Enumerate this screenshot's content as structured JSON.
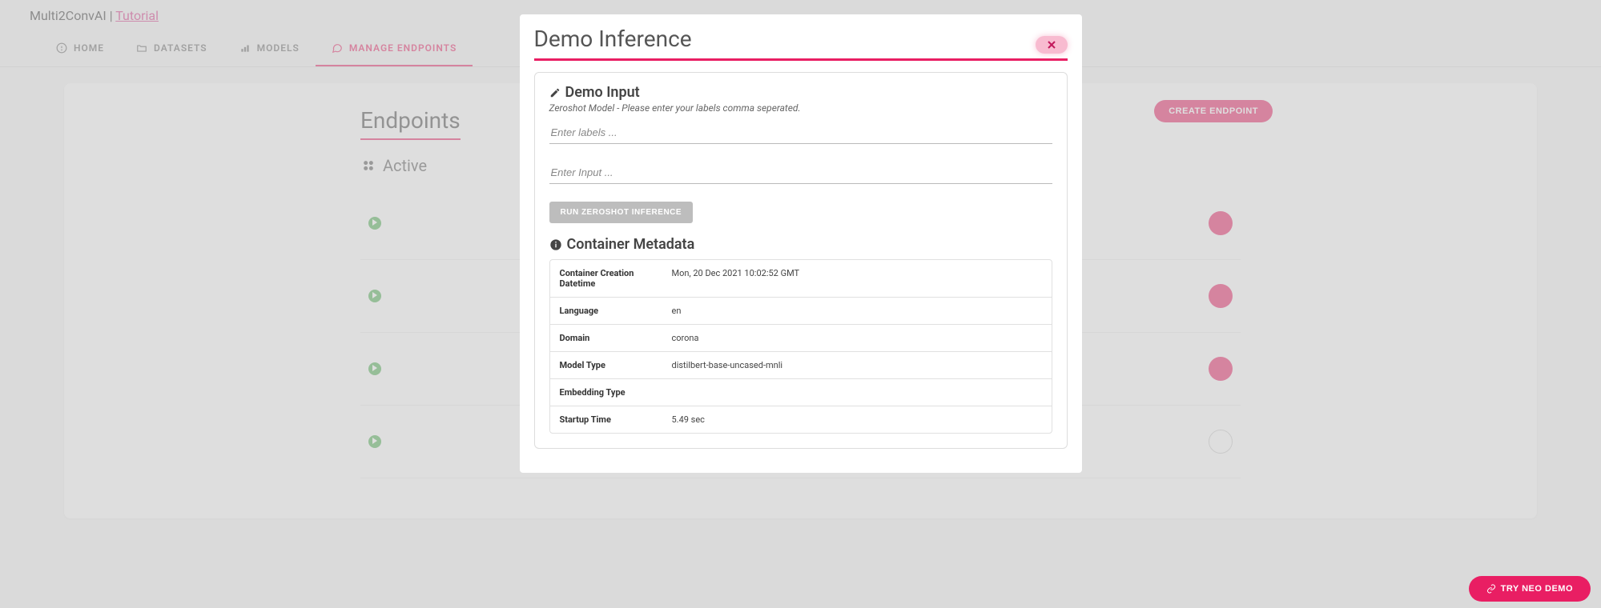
{
  "header": {
    "brand": "Multi2ConvAI",
    "sep": " | ",
    "tutorial": "Tutorial"
  },
  "nav": {
    "home": "HOME",
    "datasets": "DATASETS",
    "models": "MODELS",
    "manage": "MANAGE ENDPOINTS"
  },
  "page": {
    "title": "Endpoints",
    "create_btn": "CREATE ENDPOINT",
    "active_section": "Active"
  },
  "modal": {
    "title": "Demo Inference",
    "demo_input_heading": "Demo Input",
    "hint": "Zeroshot Model - Please enter your labels comma seperated.",
    "labels_placeholder": "Enter labels ...",
    "input_placeholder": "Enter Input ...",
    "run_btn": "RUN ZEROSHOT INFERENCE",
    "metadata_heading": "Container Metadata",
    "rows": [
      {
        "k": "Container Creation Datetime",
        "v": "Mon, 20 Dec 2021 10:02:52 GMT"
      },
      {
        "k": "Language",
        "v": "en"
      },
      {
        "k": "Domain",
        "v": "corona"
      },
      {
        "k": "Model Type",
        "v": "distilbert-base-uncased-mnli"
      },
      {
        "k": "Embedding Type",
        "v": ""
      },
      {
        "k": "Startup Time",
        "v": "5.49 sec"
      }
    ]
  },
  "footer": {
    "try_demo": "TRY NEO DEMO"
  }
}
